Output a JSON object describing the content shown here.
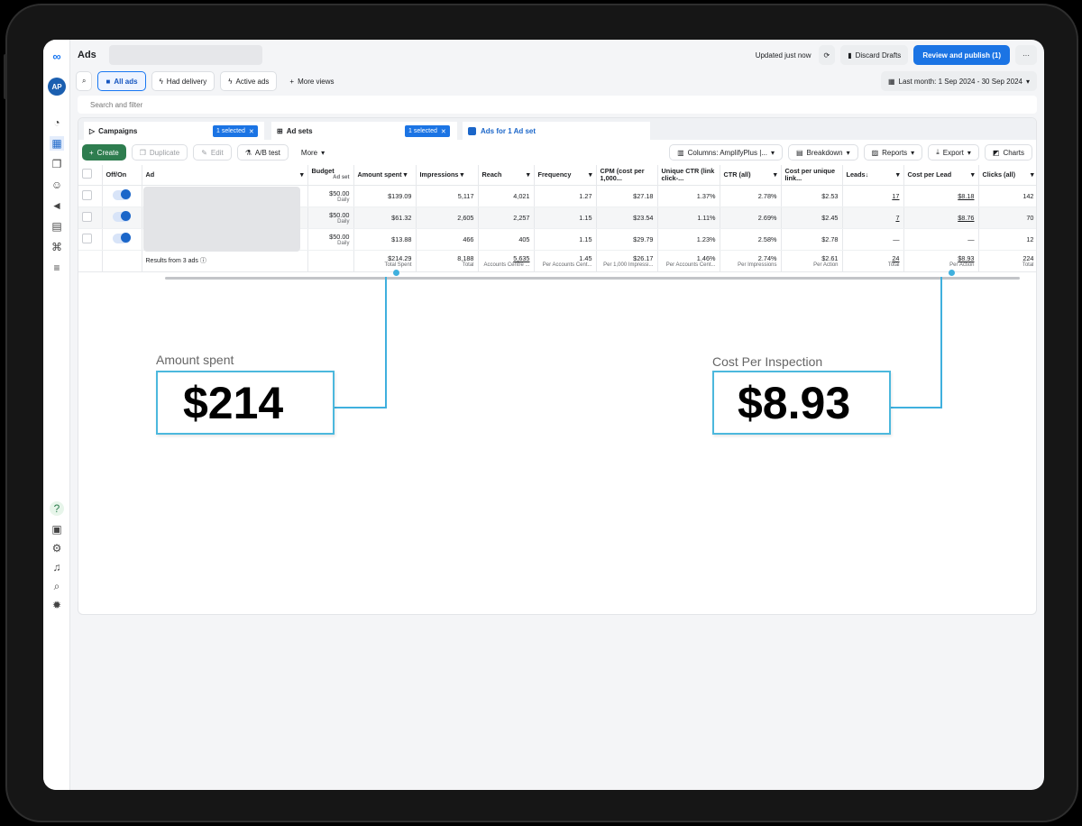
{
  "topbar": {
    "app_title": "Ads",
    "updated": "Updated just now",
    "discard": "Discard Drafts",
    "publish": "Review and publish (1)",
    "more": "···"
  },
  "filters": {
    "all_ads": "All ads",
    "had_delivery": "Had delivery",
    "active_ads": "Active ads",
    "more_views": "More views",
    "date_range": "Last month: 1 Sep 2024 - 30 Sep 2024",
    "search_placeholder": "Search and filter"
  },
  "tabs": {
    "campaigns": "Campaigns",
    "campaigns_tag": "1 selected",
    "adsets": "Ad sets",
    "adsets_tag": "1 selected",
    "ads": "Ads for 1 Ad set"
  },
  "toolbar": {
    "create": "Create",
    "duplicate": "Duplicate",
    "edit": "Edit",
    "ab_test": "A/B test",
    "more": "More",
    "columns": "Columns: AmplifyPlus |...",
    "breakdown": "Breakdown",
    "reports": "Reports",
    "export": "Export",
    "charts": "Charts"
  },
  "table": {
    "headers": {
      "offon": "Off/On",
      "ad": "Ad",
      "budget": "Budget",
      "budget_sub": "Ad set",
      "amount": "Amount spent",
      "impressions": "Impressions",
      "reach": "Reach",
      "frequency": "Frequency",
      "cpm": "CPM (cost per 1,000...",
      "ctr_unique": "Unique CTR (link click-...",
      "ctr": "CTR (all)",
      "cost_unique": "Cost per unique link...",
      "leads": "Leads↓",
      "cpl": "Cost per Lead",
      "clicks": "Clicks (all)"
    },
    "rows": [
      {
        "budget": "$50.00",
        "budget_sub": "Daily",
        "amount": "$139.09",
        "impressions": "5,117",
        "reach": "4,021",
        "frequency": "1.27",
        "cpm": "$27.18",
        "ctr_unique": "1.37%",
        "ctr": "2.78%",
        "cost_unique": "$2.53",
        "leads": "17",
        "cpl": "$8.18",
        "clicks": "142"
      },
      {
        "budget": "$50.00",
        "budget_sub": "Daily",
        "amount": "$61.32",
        "impressions": "2,605",
        "reach": "2,257",
        "frequency": "1.15",
        "cpm": "$23.54",
        "ctr_unique": "1.11%",
        "ctr": "2.69%",
        "cost_unique": "$2.45",
        "leads": "7",
        "cpl": "$8.76",
        "clicks": "70"
      },
      {
        "budget": "$50.00",
        "budget_sub": "Daily",
        "amount": "$13.88",
        "impressions": "466",
        "reach": "405",
        "frequency": "1.15",
        "cpm": "$29.79",
        "ctr_unique": "1.23%",
        "ctr": "2.58%",
        "cost_unique": "$2.78",
        "leads": "—",
        "cpl": "—",
        "clicks": "12"
      }
    ],
    "totals": {
      "label": "Results from 3 ads",
      "amount": "$214.29",
      "amount_sub": "Total Spent",
      "impressions": "8,188",
      "impressions_sub": "Total",
      "reach": "5,635",
      "reach_sub": "Accounts Centre ...",
      "frequency": "1.45",
      "frequency_sub": "Per Accounts Cent...",
      "cpm": "$26.17",
      "cpm_sub": "Per 1,000 Impressi...",
      "ctr_unique": "1.46%",
      "ctr_unique_sub": "Per Accounts Cent...",
      "ctr": "2.74%",
      "ctr_sub": "Per Impressions",
      "cost_unique": "$2.61",
      "cost_unique_sub": "Per Action",
      "leads": "24",
      "leads_sub": "Total",
      "cpl": "$8.93",
      "cpl_sub": "Per Action",
      "clicks": "224",
      "clicks_sub": "Total"
    }
  },
  "callouts": {
    "left_label": "Amount spent",
    "left_value": "$214",
    "right_label": "Cost Per Inspection",
    "right_value": "$8.93"
  },
  "colors": {
    "accent": "#1b74e4",
    "callout": "#3fb0de",
    "create": "#2e7d4f"
  }
}
